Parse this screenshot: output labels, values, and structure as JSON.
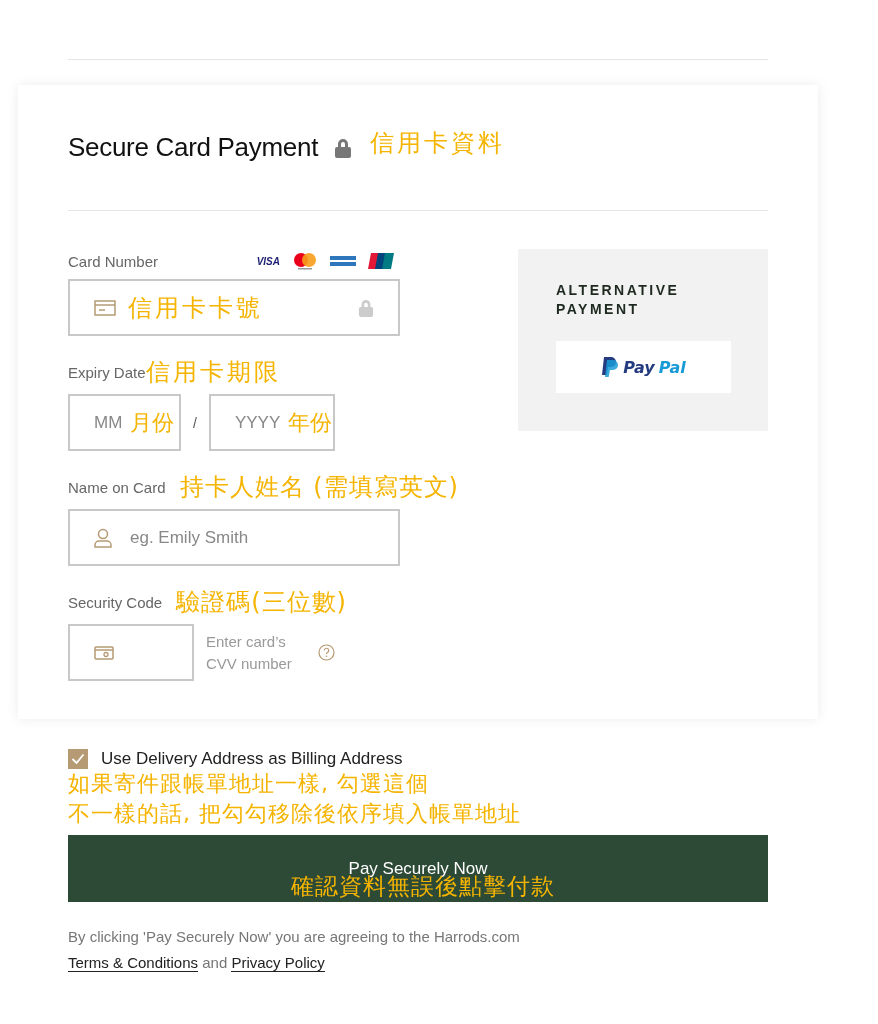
{
  "header": {
    "title": "Secure Card Payment",
    "annotation": "信用卡資料"
  },
  "card_number": {
    "label": "Card Number",
    "visa": "VISA",
    "annotation": "信用卡卡號"
  },
  "expiry": {
    "label": "Expiry Date",
    "annotation": "信用卡期限",
    "month_placeholder": "MM",
    "month_annotation": "月份",
    "separator": "/",
    "year_placeholder": "YYYY",
    "year_annotation": "年份"
  },
  "name": {
    "label": "Name on Card",
    "annotation": "持卡人姓名 (需填寫英文)",
    "placeholder": "eg. Emily Smith"
  },
  "security": {
    "label": "Security Code",
    "annotation": "驗證碼(三位數)",
    "hint": "Enter card’s CVV number"
  },
  "alternative": {
    "title": "ALTERNATIVE PAYMENT",
    "paypal_pay": "Pay",
    "paypal_pal": "Pal"
  },
  "billing": {
    "label": "Use Delivery Address as Billing Address",
    "checked": true,
    "annotation_lines": [
      "如果寄件跟帳單地址一樣, 勾選這個",
      "不一樣的話, 把勾勾移除後依序填入帳單地址"
    ]
  },
  "pay_button": {
    "label": "Pay Securely Now",
    "annotation": "確認資料無誤後點擊付款"
  },
  "legal": {
    "text": "By clicking 'Pay Securely Now' you are agreeing to the Harrods.com",
    "terms": "Terms & Conditions",
    "and": "and",
    "privacy": "Privacy Policy"
  }
}
